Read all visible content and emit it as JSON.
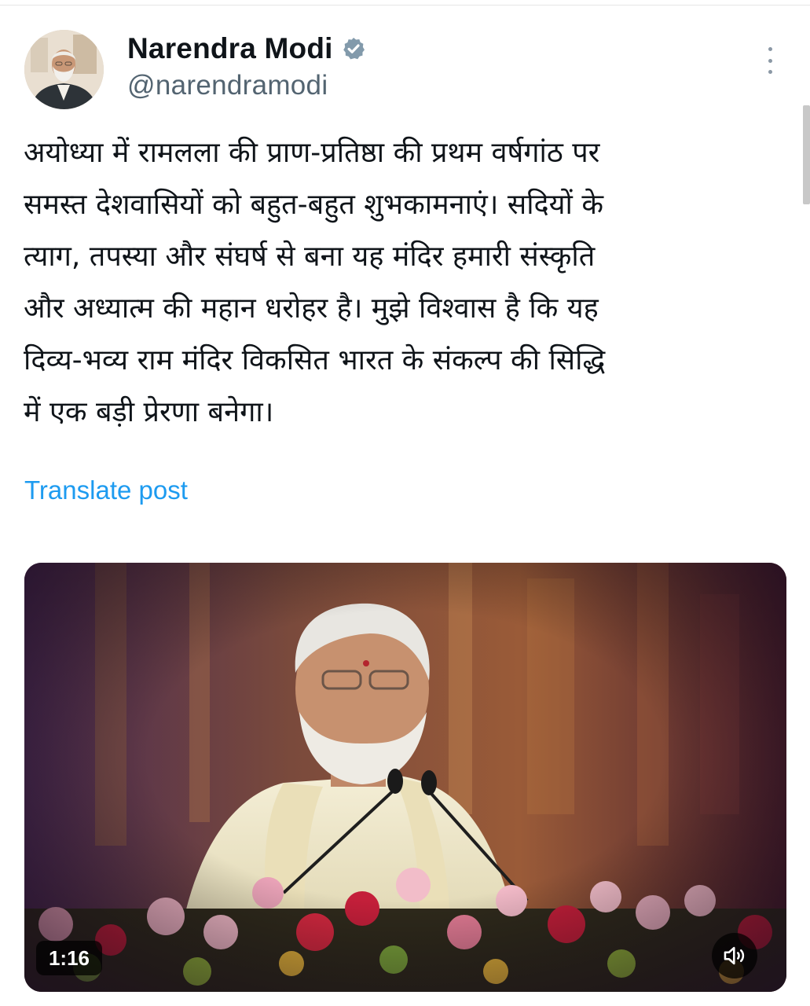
{
  "author": {
    "name": "Narendra Modi",
    "handle": "@narendramodi",
    "verified_color": "#829aab"
  },
  "post": {
    "lines": [
      "अयोध्या में रामलला की प्राण-प्रतिष्ठा की प्रथम वर्षगांठ पर",
      "समस्त देशवासियों को बहुत-बहुत शुभकामनाएं। सदियों के",
      "त्याग, तपस्या और संघर्ष से बना यह मंदिर हमारी संस्कृति",
      "और अध्यात्म की महान धरोहर है। मुझे विश्वास है कि यह",
      "दिव्य-भव्य राम मंदिर विकसित भारत के संकल्प की सिद्धि",
      "में एक बड़ी प्रेरणा बनेगा।"
    ],
    "translate_label": "Translate post",
    "link_color": "#1d9bf0"
  },
  "video": {
    "duration": "1:16",
    "mute_icon": "speaker-muted-icon"
  },
  "icons": {
    "more": "more-vertical-icon",
    "verified": "verified-badge-icon"
  }
}
